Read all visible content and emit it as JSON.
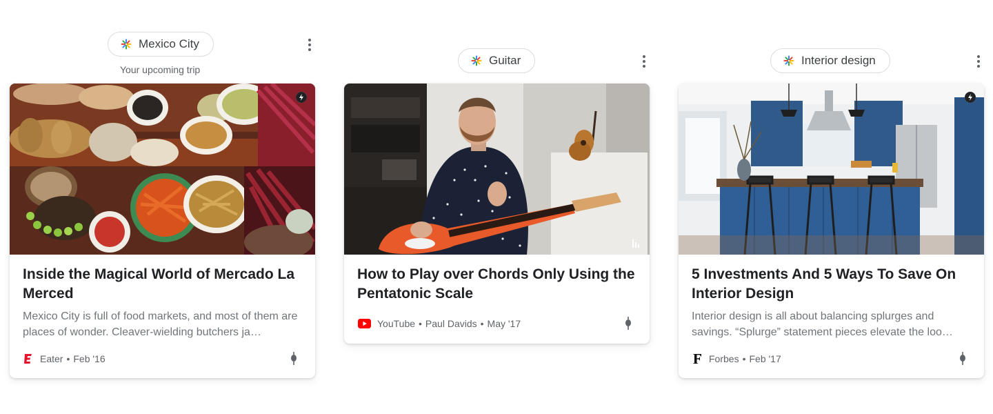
{
  "cards": [
    {
      "chip": "Mexico City",
      "chip_subtitle": "Your upcoming trip",
      "title": "Inside the Magical World of Mercado La Merced",
      "snippet": "Mexico City is full of food markets, and most of them are places of wonder. Cleaver-wielding butchers ja…",
      "source": "Eater",
      "date": "Feb '16",
      "source_icon": "eater-logo-icon",
      "badge_icon": "amp-lightning-icon"
    },
    {
      "chip": "Guitar",
      "title": "How to Play over Chords Only Using the Pentatonic Scale",
      "source": "YouTube",
      "author": "Paul Davids",
      "date": "May '17",
      "source_icon": "youtube-play-icon",
      "badge_icon": "video-bars-icon"
    },
    {
      "chip": "Interior design",
      "title": "5 Investments And 5 Ways To Save On Interior Design",
      "snippet": "Interior design is all about balancing splurges and savings. “Splurge” statement pieces elevate the loo…",
      "source": "Forbes",
      "date": "Feb '17",
      "source_icon": "forbes-logo-icon",
      "badge_icon": "amp-lightning-icon"
    }
  ],
  "meta_separator": "•",
  "colors": {
    "eater_red": "#e3142c",
    "youtube_red": "#ff0000",
    "chip_border": "#dadce0"
  }
}
